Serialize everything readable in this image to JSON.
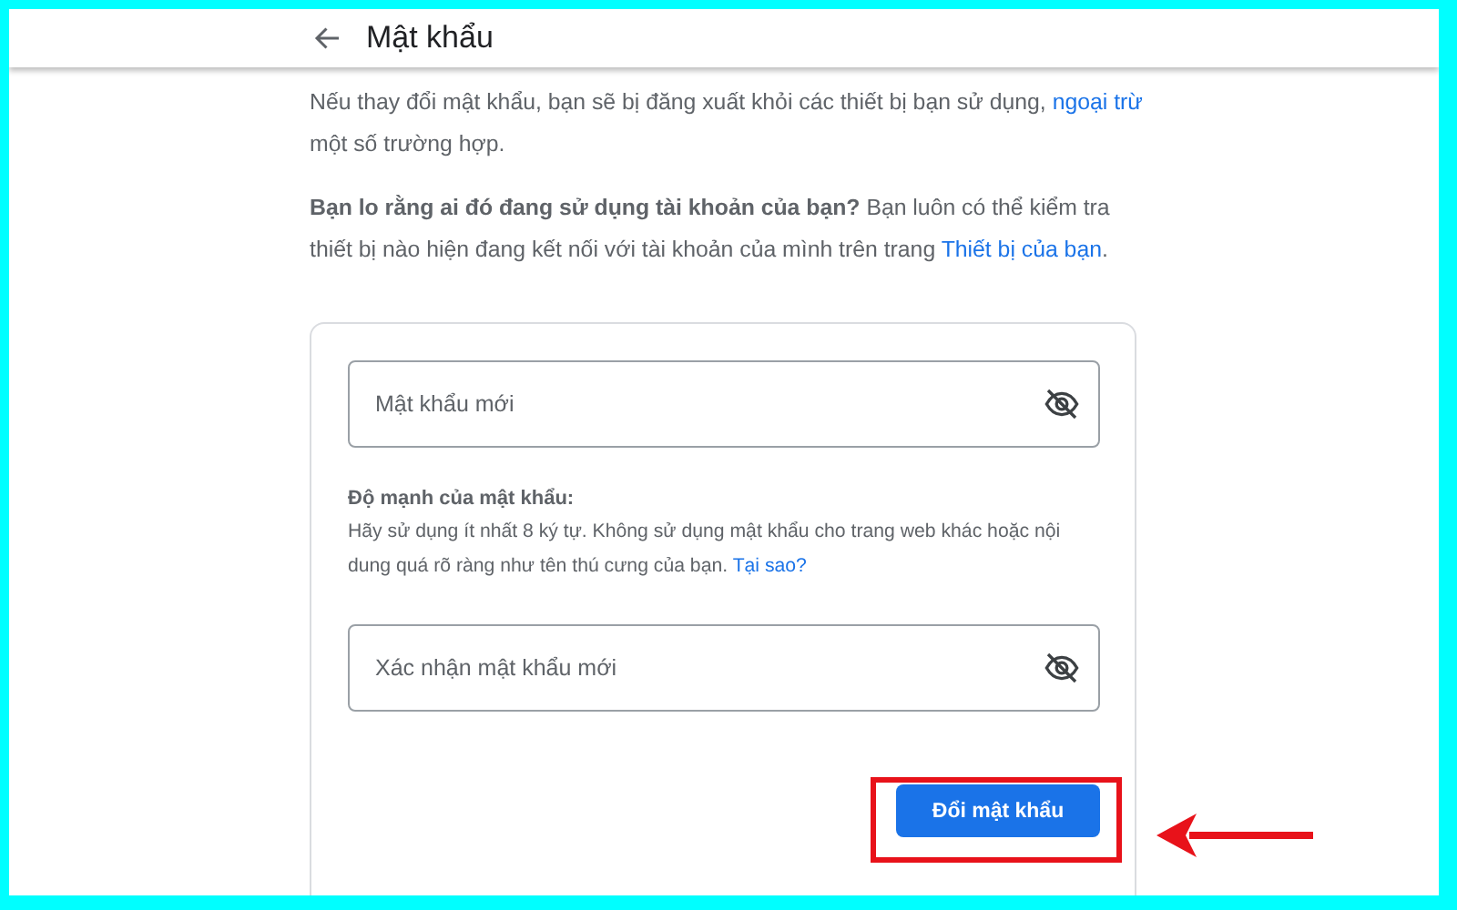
{
  "header": {
    "title": "Mật khẩu"
  },
  "intro": {
    "before": "Nếu thay đổi mật khẩu, bạn sẽ bị đăng xuất khỏi các thiết bị bạn sử dụng, ",
    "link": "ngoại trừ",
    "after": " một số trường hợp."
  },
  "concern": {
    "before": "**Bạn lo rằng ai đó đang sử dụng tài khoản của bạn?** Bạn luôn có thể kiểm tra thiết bị nào hiện đang kết nối với tài khoản của mình trên trang ",
    "link": "Thiết bị của bạn",
    "after": "."
  },
  "new_password": {
    "placeholder": "Mật khẩu mới",
    "revealed": false
  },
  "strength": {
    "title": "Độ mạnh của mật khẩu:",
    "hint": "Hãy sử dụng ít nhất 8 ký tự. Không sử dụng mật khẩu cho trang web khác hoặc nội dung quá rõ ràng như tên thú cưng của bạn.",
    "link": "Tại sao?"
  },
  "confirm_password": {
    "placeholder": "Xác nhận mật khẩu mới",
    "revealed": false
  },
  "submit": {
    "label": "Đổi mật khẩu",
    "highlighted": true
  }
}
